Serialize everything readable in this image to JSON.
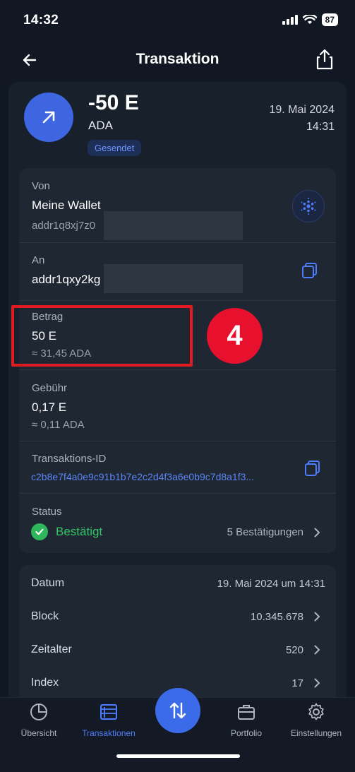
{
  "status_bar": {
    "time": "14:32",
    "battery": "87"
  },
  "header": {
    "title": "Transaktion"
  },
  "summary": {
    "amount": "-50 E",
    "asset": "ADA",
    "badge": "Gesendet",
    "date": "19. Mai 2024",
    "time": "14:31"
  },
  "details": {
    "from_label": "Von",
    "from_name": "Meine Wallet",
    "from_address": "addr1q8xj7z0",
    "to_label": "An",
    "to_address": "addr1qxy2kg",
    "amount_label": "Betrag",
    "amount_value": "50 E",
    "amount_converted": "≈ 31,45 ADA",
    "fee_label": "Gebühr",
    "fee_value": "0,17 E",
    "fee_converted": "≈ 0,11 ADA",
    "txid_label": "Transaktions-ID",
    "txid_value": "c2b8e7f4a0e9c91b1b7e2c2d4f3a6e0b9c7d8a1f3...",
    "status_label": "Status",
    "status_value": "Bestätigt",
    "confirmations": "5 Bestätigungen"
  },
  "annotation": {
    "step": "4"
  },
  "meta": {
    "rows": [
      {
        "label": "Datum",
        "value": "19. Mai 2024 um 14:31"
      },
      {
        "label": "Block",
        "value": "10.345.678"
      },
      {
        "label": "Zeitalter",
        "value": "520"
      },
      {
        "label": "Index",
        "value": "17"
      }
    ]
  },
  "tabs": [
    {
      "label": "Übersicht",
      "icon": "pie-chart-icon",
      "active": false
    },
    {
      "label": "Transaktionen",
      "icon": "list-icon",
      "active": true
    },
    {
      "label": "Portfolio",
      "icon": "briefcase-icon",
      "active": false
    },
    {
      "label": "Einstellungen",
      "icon": "gear-icon",
      "active": false
    }
  ],
  "colors": {
    "accent": "#3d66e0",
    "success": "#34c466",
    "highlight": "#e01c22",
    "background": "#111823"
  }
}
